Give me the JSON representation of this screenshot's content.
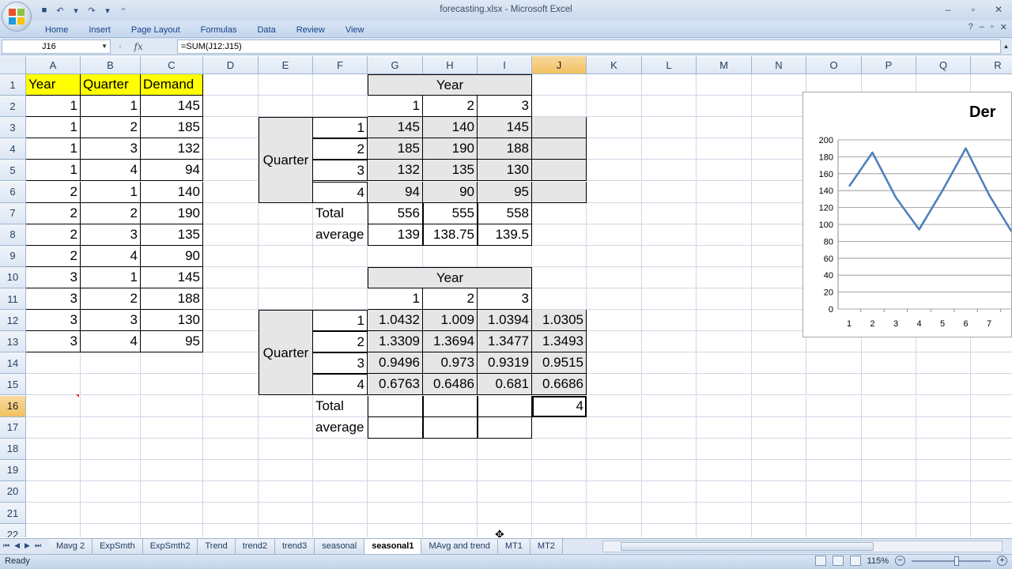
{
  "window": {
    "title": "forecasting.xlsx - Microsoft Excel",
    "controls": [
      "–",
      "▫",
      "✕"
    ],
    "ribbon_controls": [
      "?",
      "–",
      "▫",
      "✕"
    ]
  },
  "ribbon": {
    "tabs": [
      "Home",
      "Insert",
      "Page Layout",
      "Formulas",
      "Data",
      "Review",
      "View"
    ]
  },
  "formula_bar": {
    "name_box": "J16",
    "fx": "fx",
    "formula": "=SUM(J12:J15)"
  },
  "columns": [
    "A",
    "B",
    "C",
    "D",
    "E",
    "F",
    "G",
    "H",
    "I",
    "J",
    "K",
    "L",
    "M",
    "N",
    "O",
    "P",
    "Q",
    "R"
  ],
  "rows": [
    "1",
    "2",
    "3",
    "4",
    "5",
    "6",
    "7",
    "8",
    "9",
    "10",
    "11",
    "12",
    "13",
    "14",
    "15",
    "16",
    "17",
    "18",
    "19",
    "20",
    "21",
    "22"
  ],
  "data_table": {
    "headers": [
      "Year",
      "Quarter",
      "Demand"
    ],
    "rows": [
      [
        "1",
        "1",
        "145"
      ],
      [
        "1",
        "2",
        "185"
      ],
      [
        "1",
        "3",
        "132"
      ],
      [
        "1",
        "4",
        "94"
      ],
      [
        "2",
        "1",
        "140"
      ],
      [
        "2",
        "2",
        "190"
      ],
      [
        "2",
        "3",
        "135"
      ],
      [
        "2",
        "4",
        "90"
      ],
      [
        "3",
        "1",
        "145"
      ],
      [
        "3",
        "2",
        "188"
      ],
      [
        "3",
        "3",
        "130"
      ],
      [
        "3",
        "4",
        "95"
      ]
    ]
  },
  "pivot1": {
    "year_label": "Year",
    "quarter_label": "Quarter",
    "years": [
      "1",
      "2",
      "3"
    ],
    "quarters": [
      "1",
      "2",
      "3",
      "4"
    ],
    "values": [
      [
        "145",
        "140",
        "145"
      ],
      [
        "185",
        "190",
        "188"
      ],
      [
        "132",
        "135",
        "130"
      ],
      [
        "94",
        "90",
        "95"
      ]
    ],
    "total_label": "Total",
    "totals": [
      "556",
      "555",
      "558"
    ],
    "average_label": "average",
    "averages": [
      "139",
      "138.75",
      "139.5"
    ]
  },
  "pivot2": {
    "year_label": "Year",
    "quarter_label": "Quarter",
    "years": [
      "1",
      "2",
      "3"
    ],
    "quarters": [
      "1",
      "2",
      "3",
      "4"
    ],
    "values": [
      [
        "1.0432",
        "1.009",
        "1.0394",
        "1.0305"
      ],
      [
        "1.3309",
        "1.3694",
        "1.3477",
        "1.3493"
      ],
      [
        "0.9496",
        "0.973",
        "0.9319",
        "0.9515"
      ],
      [
        "0.6763",
        "0.6486",
        "0.681",
        "0.6686"
      ]
    ],
    "total_label": "Total",
    "total_j": "4",
    "average_label": "average"
  },
  "chart_data": {
    "type": "line",
    "title": "Der",
    "x": [
      1,
      2,
      3,
      4,
      5,
      6,
      7,
      8
    ],
    "x_tick_labels": [
      "1",
      "2",
      "3",
      "4",
      "5",
      "6",
      "7"
    ],
    "series": [
      {
        "values": [
          145,
          185,
          132,
          94,
          140,
          190,
          135,
          90
        ]
      }
    ],
    "yticks": [
      "0",
      "20",
      "40",
      "60",
      "80",
      "100",
      "120",
      "140",
      "160",
      "180",
      "200"
    ],
    "ylim": [
      0,
      200
    ],
    "grid": true,
    "line_color": "#4f81bd"
  },
  "sheet_tabs": [
    "Mavg 2",
    "ExpSmth",
    "ExpSmth2",
    "Trend",
    "trend2",
    "trend3",
    "seasonal",
    "seasonal1",
    "MAvg and trend",
    "MT1",
    "MT2"
  ],
  "active_sheet": "seasonal1",
  "status": {
    "left": "Ready",
    "zoom": "115%"
  }
}
